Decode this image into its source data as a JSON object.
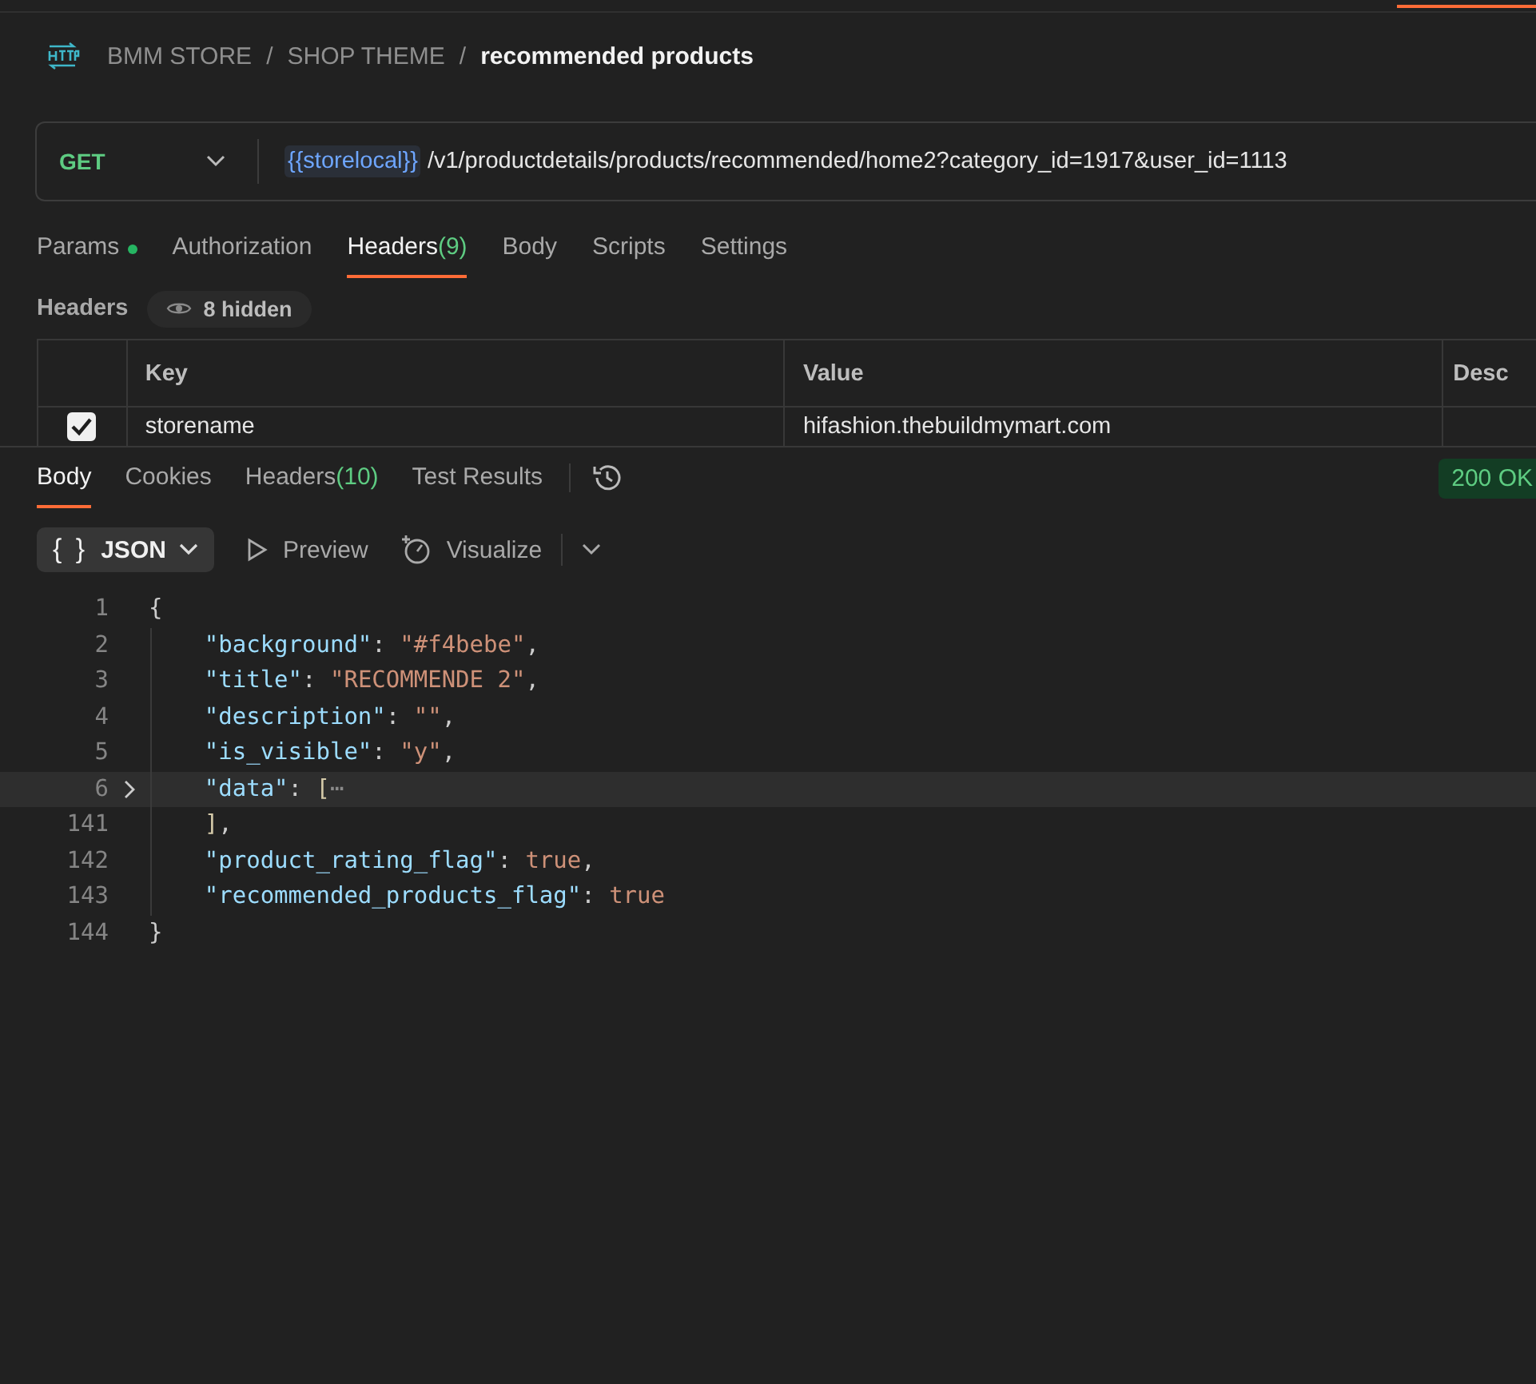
{
  "breadcrumb": [
    {
      "label": "BMM STORE",
      "current": false
    },
    {
      "label": "SHOP THEME",
      "current": false
    },
    {
      "label": "recommended products",
      "current": true
    }
  ],
  "breadcrumb_separator": "/",
  "request": {
    "method": "GET",
    "url_variable": "{{storelocal}}",
    "url_path": "/v1/productdetails/products/recommended/home2?category_id=1917&user_id=1113"
  },
  "request_tabs": [
    {
      "label": "Params",
      "dot": true,
      "selected": false
    },
    {
      "label": "Authorization",
      "dot": false,
      "selected": false
    },
    {
      "label": "Headers",
      "count": "(9)",
      "dot": false,
      "selected": true
    },
    {
      "label": "Body",
      "dot": false,
      "selected": false
    },
    {
      "label": "Scripts",
      "dot": false,
      "selected": false
    },
    {
      "label": "Settings",
      "dot": false,
      "selected": false
    }
  ],
  "headers_section": {
    "title": "Headers",
    "hidden_badge": "8 hidden"
  },
  "headers_table": {
    "columns": [
      "Key",
      "Value",
      "Desc"
    ],
    "rows": [
      {
        "checked": true,
        "key": "storename",
        "value": "hifashion.thebuildmymart.com"
      }
    ]
  },
  "response_tabs": [
    {
      "label": "Body",
      "selected": true
    },
    {
      "label": "Cookies",
      "selected": false
    },
    {
      "label": "Headers",
      "count": "(10)",
      "selected": false
    },
    {
      "label": "Test Results",
      "selected": false
    }
  ],
  "status": "200 OK",
  "response_toolbar": {
    "format": "JSON",
    "format_icon": "{ }",
    "preview": "Preview",
    "visualize": "Visualize"
  },
  "code_lines": [
    {
      "number": "1",
      "folded": false,
      "highlighted": false,
      "tokens": [
        {
          "kind": "punct",
          "text": "{"
        }
      ],
      "children": [
        {
          "number": "2",
          "folded": false,
          "highlighted": false,
          "tokens": [
            {
              "kind": "key",
              "text": "\"background\""
            },
            {
              "kind": "punct",
              "text": ": "
            },
            {
              "kind": "string",
              "text": "\"#f4bebe\""
            },
            {
              "kind": "punct",
              "text": ","
            }
          ]
        },
        {
          "number": "3",
          "folded": false,
          "highlighted": false,
          "tokens": [
            {
              "kind": "key",
              "text": "\"title\""
            },
            {
              "kind": "punct",
              "text": ": "
            },
            {
              "kind": "string",
              "text": "\"RECOMMENDE 2\""
            },
            {
              "kind": "punct",
              "text": ","
            }
          ]
        },
        {
          "number": "4",
          "folded": false,
          "highlighted": false,
          "tokens": [
            {
              "kind": "key",
              "text": "\"description\""
            },
            {
              "kind": "punct",
              "text": ": "
            },
            {
              "kind": "string",
              "text": "\"\""
            },
            {
              "kind": "punct",
              "text": ","
            }
          ]
        },
        {
          "number": "5",
          "folded": false,
          "highlighted": false,
          "tokens": [
            {
              "kind": "key",
              "text": "\"is_visible\""
            },
            {
              "kind": "punct",
              "text": ": "
            },
            {
              "kind": "string",
              "text": "\"y\""
            },
            {
              "kind": "punct",
              "text": ","
            }
          ]
        },
        {
          "number": "6",
          "folded": true,
          "highlighted": true,
          "tokens": [
            {
              "kind": "key",
              "text": "\"data\""
            },
            {
              "kind": "punct",
              "text": ": "
            },
            {
              "kind": "bracket",
              "text": "["
            },
            {
              "kind": "fold",
              "text": "⋯"
            }
          ]
        },
        {
          "number": "141",
          "folded": false,
          "highlighted": false,
          "tokens": [
            {
              "kind": "bracket",
              "text": "]"
            },
            {
              "kind": "punct",
              "text": ","
            }
          ]
        },
        {
          "number": "142",
          "folded": false,
          "highlighted": false,
          "tokens": [
            {
              "kind": "key",
              "text": "\"product_rating_flag\""
            },
            {
              "kind": "punct",
              "text": ": "
            },
            {
              "kind": "literal",
              "text": "true"
            },
            {
              "kind": "punct",
              "text": ","
            }
          ]
        },
        {
          "number": "143",
          "folded": false,
          "highlighted": false,
          "tokens": [
            {
              "kind": "key",
              "text": "\"recommended_products_flag\""
            },
            {
              "kind": "punct",
              "text": ": "
            },
            {
              "kind": "literal",
              "text": "true"
            }
          ]
        }
      ]
    },
    {
      "number": "144",
      "folded": false,
      "highlighted": false,
      "tokens": [
        {
          "kind": "punct",
          "text": "}"
        }
      ]
    }
  ]
}
